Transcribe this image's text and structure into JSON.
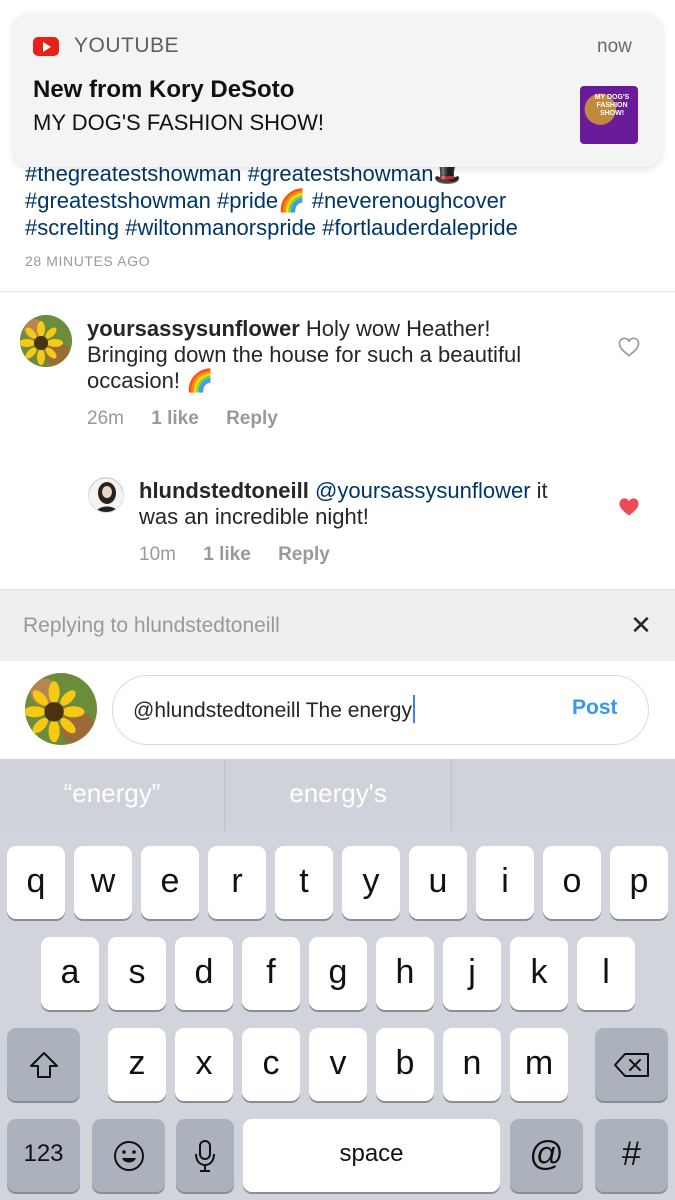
{
  "notification": {
    "app": "YOUTUBE",
    "time": "now",
    "title": "New from Kory DeSoto",
    "body": "MY DOG'S FASHION SHOW!",
    "thumbnail_text": "MY DOG'S FASHION SHOW!",
    "accent": "#e62117"
  },
  "caption": {
    "hashtag_lines": [
      [
        "#thegreatestshowman",
        "#greatestshowman",
        "🎩"
      ],
      [
        "#greatestshowman",
        "#pride",
        "🌈",
        "#neverenoughcover"
      ],
      [
        "#screlting",
        "#wiltonmanorspride",
        "#fortlauderdalepride"
      ]
    ],
    "time": "28 MINUTES AGO"
  },
  "comments": [
    {
      "user": "yoursassysunflower",
      "text_line1": "Holy wow Heather!",
      "text_line2": "Bringing down the house for such a beautiful",
      "text_line3": "occasion! 🌈",
      "time": "26m",
      "likes": "1 like",
      "reply": "Reply",
      "liked": false
    },
    {
      "user": "hlundstedtoneill",
      "mention": "@yoursassysunflower",
      "text_after_mention": "it",
      "text_line2": "was an incredible night!",
      "time": "10m",
      "likes": "1 like",
      "reply": "Reply",
      "liked": true,
      "heart_color": "#ed4956"
    }
  ],
  "reply_bar": {
    "label": "Replying to hlundstedtoneill"
  },
  "composer": {
    "value": "@hlundstedtoneill The energy",
    "post_label": "Post",
    "post_color": "#3897f0"
  },
  "keyboard": {
    "predictions": [
      "“energy”",
      "energy's",
      ""
    ],
    "row1": [
      "q",
      "w",
      "e",
      "r",
      "t",
      "y",
      "u",
      "i",
      "o",
      "p"
    ],
    "row2": [
      "a",
      "s",
      "d",
      "f",
      "g",
      "h",
      "j",
      "k",
      "l"
    ],
    "row3": [
      "z",
      "x",
      "c",
      "v",
      "b",
      "n",
      "m"
    ],
    "numbers_label": "123",
    "space_label": "space",
    "at_label": "@",
    "hash_label": "#"
  }
}
